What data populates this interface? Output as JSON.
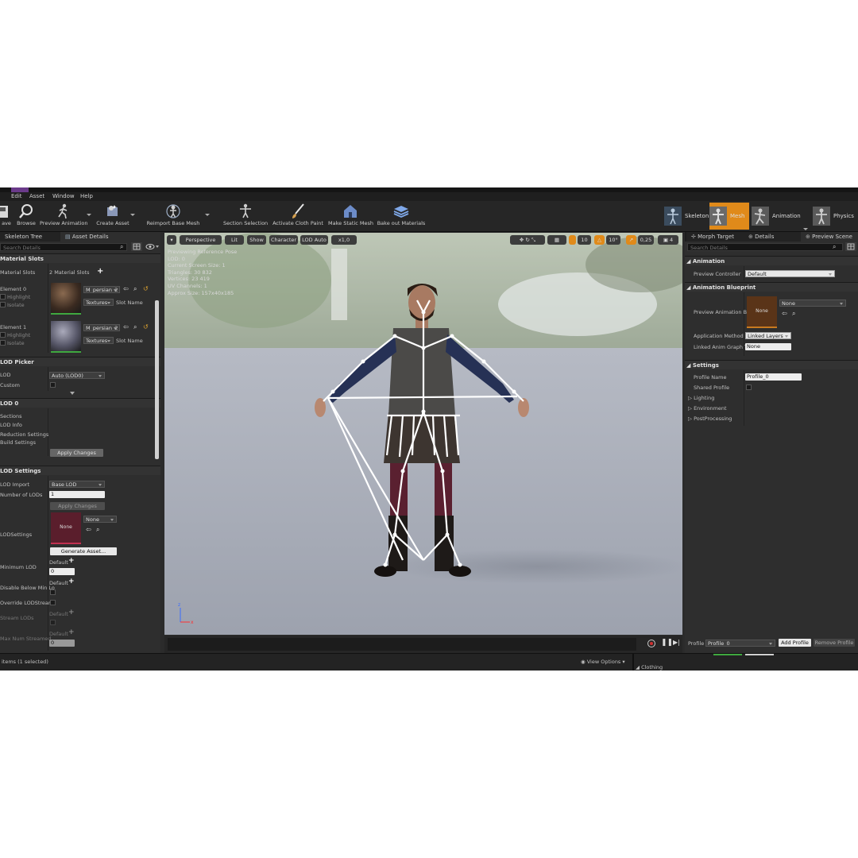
{
  "menu": [
    "Edit",
    "Asset",
    "Window",
    "Help"
  ],
  "toolbar": {
    "save_partial": "ave",
    "browse": "Browse",
    "preview_animation": "Preview Animation",
    "create_asset": "Create Asset",
    "reimport": "Reimport Base Mesh",
    "section_selection": "Section Selection",
    "activate_cloth": "Activate Cloth Paint",
    "make_static": "Make Static Mesh",
    "bake_out": "Bake out Materials"
  },
  "modes": {
    "skeleton": "Skeleton",
    "mesh": "Mesh",
    "animation": "Animation",
    "physics": "Physics"
  },
  "left": {
    "tabs": [
      "Skeleton Tree",
      "Asset Details"
    ],
    "search_placeholder": "Search Details",
    "material_slots": {
      "header": "Material Slots",
      "label": "Material Slots",
      "count": "2 Material Slots",
      "elements": [
        {
          "name": "Element 0",
          "material": "M_persian_2",
          "textures": "Textures",
          "slot": "Slot Name",
          "highlight": "Highlight",
          "isolate": "Isolate"
        },
        {
          "name": "Element 1",
          "material": "M_persian_2",
          "textures": "Textures",
          "slot": "Slot Name",
          "highlight": "Highlight",
          "isolate": "Isolate"
        }
      ]
    },
    "lod_picker": {
      "header": "LOD Picker",
      "lod_label": "LOD",
      "lod_value": "Auto (LOD0)",
      "custom": "Custom"
    },
    "lod0": {
      "header": "LOD 0",
      "sections": "Sections",
      "lod_info": "LOD Info",
      "reduction": "Reduction Settings",
      "build": "Build Settings",
      "apply": "Apply Changes"
    },
    "lod_settings": {
      "header": "LOD Settings",
      "import_label": "LOD Import",
      "import_value": "Base LOD",
      "num_label": "Number of LODs",
      "num_value": "1",
      "apply": "Apply Changes",
      "lodsettings_label": "LODSettings",
      "thumb_none": "None",
      "combo_none": "None",
      "generate": "Generate Asset...",
      "min_lod_label": "Minimum LOD",
      "default": "Default",
      "min_lod_value": "0",
      "disable_below": "Disable Below Min Lo",
      "override": "Override LODStreami",
      "stream": "Stream LODs",
      "max_num": "Max Num Streamed",
      "max_num_value": "0"
    },
    "status": "items (1 selected)"
  },
  "viewport": {
    "perspective": "Perspective",
    "lit": "Lit",
    "show": "Show",
    "character": "Character",
    "lod_auto": "LOD Auto",
    "speed": "x1,0",
    "snap1": "10",
    "snap2": "10°",
    "snap3": "0,25",
    "snap4": "4",
    "stats": [
      "Previewing Reference Pose",
      "LOD: 0",
      "Current Screen Size: 1",
      "Triangles: 30 832",
      "Vertices: 23 419",
      "UV Channels: 1",
      "Approx Size: 157x40x185"
    ],
    "view_options": "View Options"
  },
  "right": {
    "tabs": [
      "Morph Target",
      "Details",
      "Preview Scene"
    ],
    "search_placeholder": "Search Details",
    "animation": {
      "header": "Animation",
      "preview_controller_label": "Preview Controller",
      "preview_controller_value": "Default"
    },
    "anim_bp": {
      "header": "Animation Blueprint",
      "preview_bp_label": "Preview Animation Bl",
      "thumb_none": "None",
      "combo_none": "None",
      "app_method_label": "Application Method",
      "app_method_value": "Linked Layers",
      "linked_label": "Linked Anim Graph Ta",
      "linked_value": "None"
    },
    "settings": {
      "header": "Settings",
      "profile_name_label": "Profile Name",
      "profile_name_value": "Profile_0",
      "shared_label": "Shared Profile",
      "lighting": "Lighting",
      "environment": "Environment",
      "postprocessing": "PostProcessing"
    },
    "profile_label": "Profile",
    "profile_value": "Profile_0",
    "add_profile": "Add Profile",
    "remove_profile": "Remove Profile",
    "clothing": "Clothing"
  },
  "colors": {
    "accent_orange": "#e08a1a",
    "panel_bg": "#2e2e2e",
    "floor": "#aeb2bc",
    "bone": "#ffffff"
  }
}
